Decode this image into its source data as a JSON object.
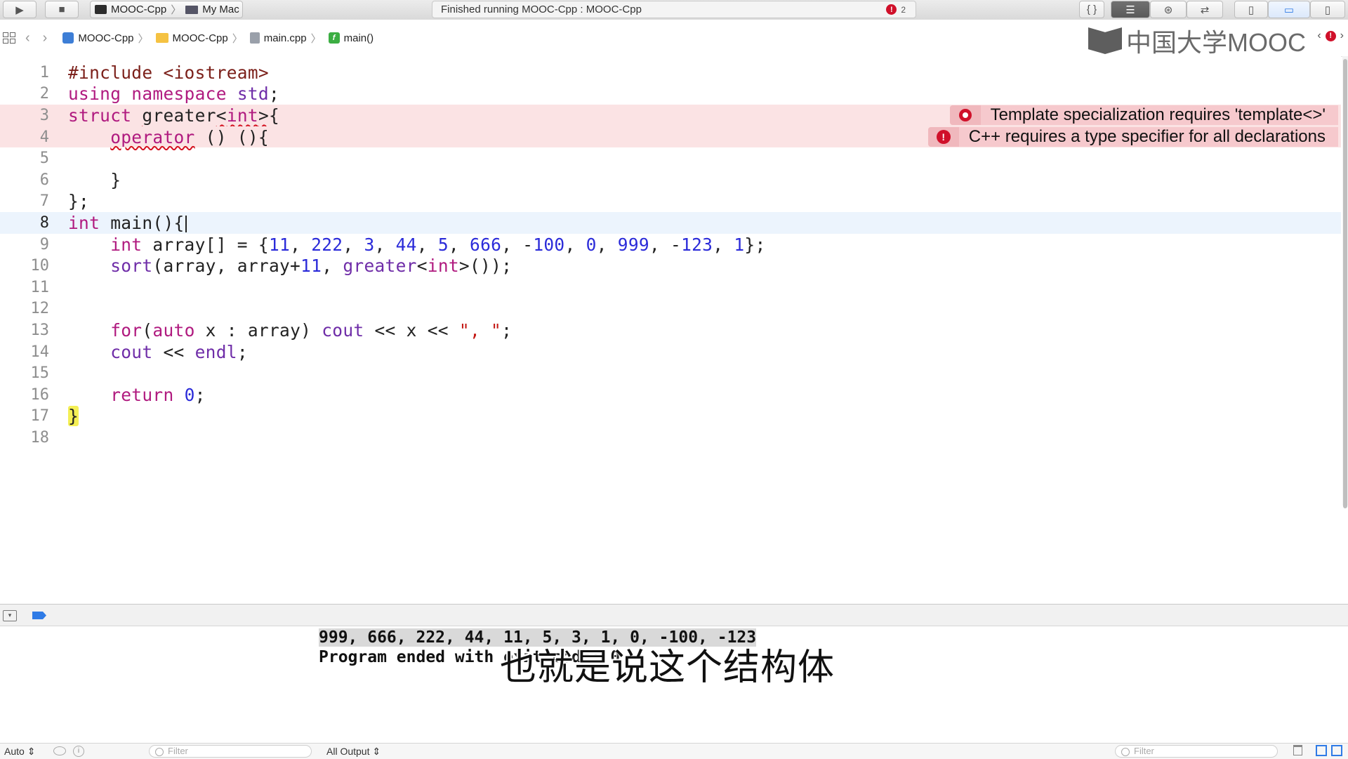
{
  "toolbar": {
    "scheme_name": "MOOC-Cpp",
    "destination": "My Mac",
    "activity_text": "Finished running MOOC-Cpp : MOOC-Cpp",
    "error_count": "2"
  },
  "jumpbar": {
    "crumbs": [
      "MOOC-Cpp",
      "MOOC-Cpp",
      "main.cpp",
      "main()"
    ],
    "watermark": "中国大学MOOC"
  },
  "editor": {
    "line_numbers": [
      "1",
      "2",
      "3",
      "4",
      "5",
      "6",
      "7",
      "8",
      "9",
      "10",
      "11",
      "12",
      "13",
      "14",
      "15",
      "16",
      "17",
      "18"
    ],
    "current_line": 8,
    "error_lines": [
      3,
      4
    ],
    "code": {
      "l1": "#include <iostream>",
      "l2": "using namespace std;",
      "l3": "struct greater<int>{",
      "l4": "    operator () (){",
      "l5": "",
      "l6": "    }",
      "l7": "};",
      "l8": "int main(){",
      "l9": "    int array[] = {11, 222, 3, 44, 5, 666, -100, 0, 999, -123, 1};",
      "l10": "    sort(array, array+11, greater<int>());",
      "l11": "",
      "l12": "",
      "l13": "    for(auto x : array) cout << x << \", \";",
      "l14": "    cout << endl;",
      "l15": "",
      "l16": "    return 0;",
      "l17": "}",
      "l18": ""
    },
    "issues": [
      {
        "line": 3,
        "message": "Template specialization requires 'template<>'"
      },
      {
        "line": 4,
        "message": "C++ requires a type specifier for all declarations"
      }
    ]
  },
  "debug": {
    "console_output": [
      "999, 666, 222, 44, 11, 5, 3, 1, 0, -100, -123",
      "Program ended with exit code: 0"
    ],
    "subtitle": "也就是说这个结构体",
    "variables_scope": "Auto",
    "variables_filter_placeholder": "Filter",
    "output_scope": "All Output",
    "console_filter_placeholder": "Filter"
  },
  "colors": {
    "keyword": "#b01a7f",
    "preprocessor": "#7b1f19",
    "number": "#2b2bd9",
    "string": "#c41a16",
    "error_line_bg": "#fbe3e4",
    "current_line_bg": "#ecf4fd",
    "error_red": "#d0102a"
  }
}
